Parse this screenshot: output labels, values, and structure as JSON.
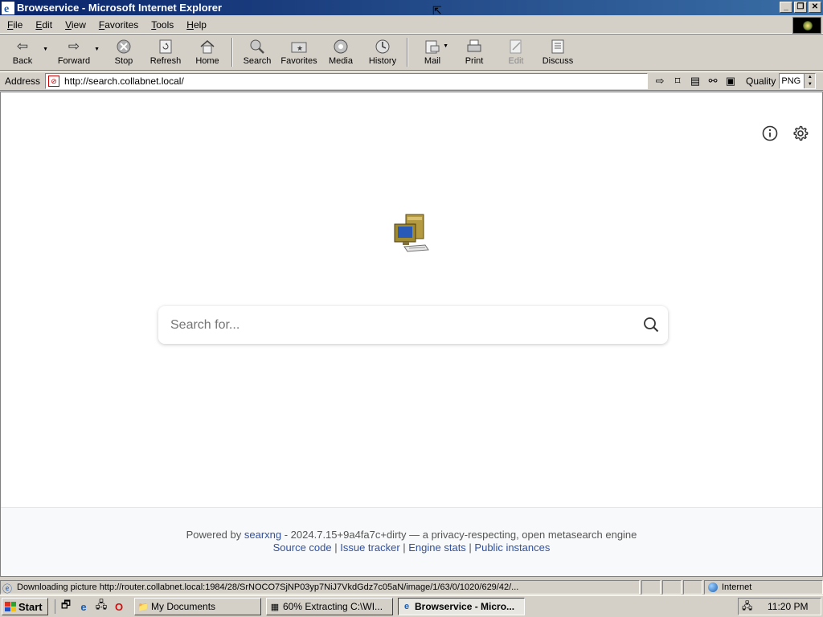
{
  "window": {
    "title": "Browservice - Microsoft Internet Explorer",
    "minimize": "_",
    "restore": "❐",
    "close": "✕"
  },
  "menu": [
    {
      "key": "F",
      "rest": "ile"
    },
    {
      "key": "E",
      "rest": "dit"
    },
    {
      "key": "V",
      "rest": "iew"
    },
    {
      "key": "F",
      "rest": "avorites",
      "display": "Favorites"
    },
    {
      "key": "T",
      "rest": "ools"
    },
    {
      "key": "H",
      "rest": "elp"
    }
  ],
  "toolbar": {
    "back": "Back",
    "forward": "Forward",
    "stop": "Stop",
    "refresh": "Refresh",
    "home": "Home",
    "search": "Search",
    "favorites": "Favorites",
    "media": "Media",
    "history": "History",
    "mail": "Mail",
    "print": "Print",
    "edit": "Edit",
    "discuss": "Discuss"
  },
  "address": {
    "label": "Address",
    "url": "http://search.collabnet.local/",
    "quality_label": "Quality",
    "quality_value": "PNG"
  },
  "page": {
    "search_placeholder": "Search for...",
    "footer": {
      "powered_by": "Powered by",
      "engine_link": "searxng",
      "version_text": " - 2024.7.15+9a4fa7c+dirty — a privacy-respecting, open metasearch engine",
      "links": [
        "Source code",
        "Issue tracker",
        "Engine stats",
        "Public instances"
      ],
      "separator": " | "
    }
  },
  "status": {
    "text": "Downloading picture http://router.collabnet.local:1984/28/SrNOCO7SjNP03yp7NiJ7VkdGdz7c05aN/image/1/63/0/1020/629/42/...",
    "zone": "Internet"
  },
  "taskbar": {
    "start": "Start",
    "tasks": [
      {
        "label": "My Documents",
        "icon": "folder-icon",
        "active": false
      },
      {
        "label": "60% Extracting C:\\WI...",
        "icon": "archive-icon",
        "active": false
      },
      {
        "label": "Browservice - Micro...",
        "icon": "ie-icon",
        "active": true
      }
    ],
    "clock": "11:20 PM"
  },
  "colors": {
    "title_start": "#0a246a",
    "title_end": "#3a6ea5",
    "link": "#3050a0",
    "chrome": "#d4d0c8"
  }
}
